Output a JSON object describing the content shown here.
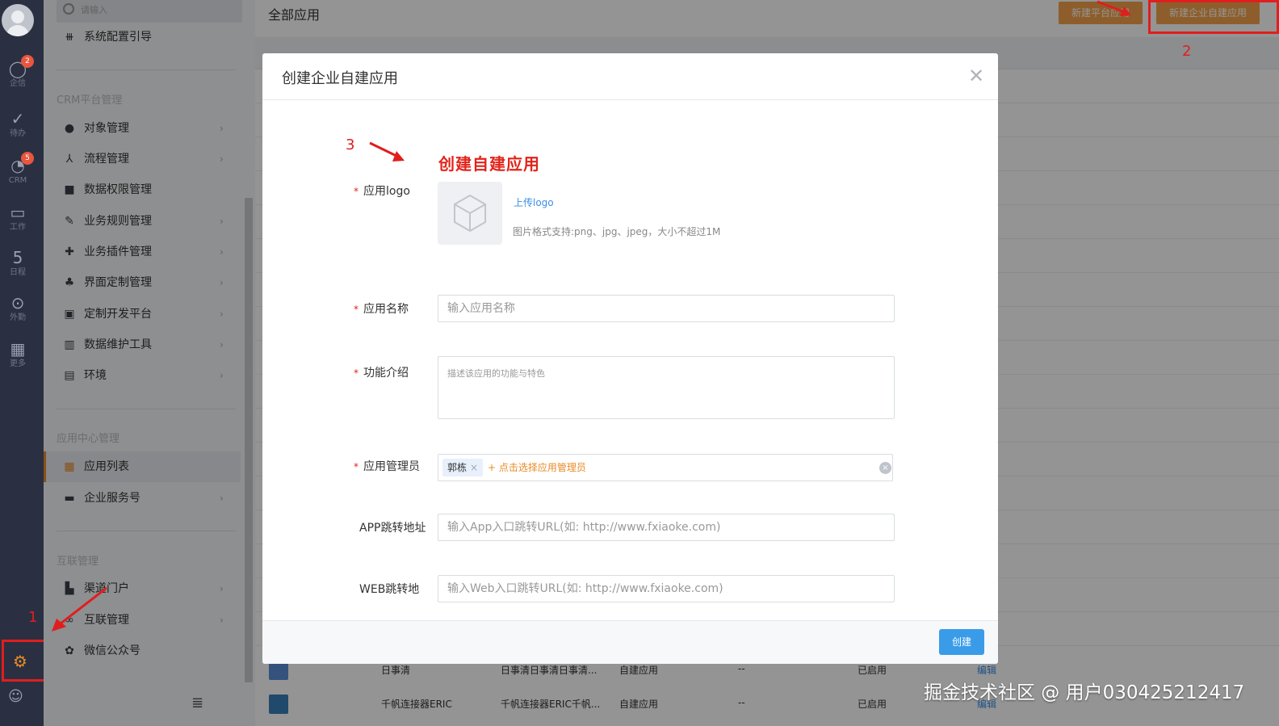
{
  "rail": {
    "items": [
      {
        "icon": "chat-icon",
        "glyph": "◯",
        "label": "企信",
        "badge": "2"
      },
      {
        "icon": "check-icon",
        "glyph": "✓",
        "label": "待办",
        "badge": ""
      },
      {
        "icon": "clock-icon",
        "glyph": "◔",
        "label": "CRM",
        "badge": "5"
      },
      {
        "icon": "briefcase-icon",
        "glyph": "▭",
        "label": "工作",
        "badge": ""
      },
      {
        "icon": "calendar-icon",
        "glyph": "5",
        "label": "日程",
        "badge": ""
      },
      {
        "icon": "location-icon",
        "glyph": "⊙",
        "label": "外勤",
        "badge": ""
      },
      {
        "icon": "grid-icon",
        "glyph": "▦",
        "label": "更多",
        "badge": ""
      }
    ],
    "settings_glyph": "⚙",
    "contacts_glyph": "☺"
  },
  "nav": {
    "search_placeholder": "请输入",
    "top_item": "系统配置引导",
    "group_crm": "CRM平台管理",
    "crm_items": [
      {
        "label": "对象管理",
        "icon": "user-icon",
        "glyph": "●",
        "chevron": true
      },
      {
        "label": "流程管理",
        "icon": "flow-icon",
        "glyph": "⅄",
        "chevron": true
      },
      {
        "label": "数据权限管理",
        "icon": "lock-icon",
        "glyph": "■",
        "chevron": false
      },
      {
        "label": "业务规则管理",
        "icon": "wrench-icon",
        "glyph": "✎",
        "chevron": true
      },
      {
        "label": "业务插件管理",
        "icon": "puzzle-icon",
        "glyph": "✚",
        "chevron": true
      },
      {
        "label": "界面定制管理",
        "icon": "paint-icon",
        "glyph": "♣",
        "chevron": true
      },
      {
        "label": "定制开发平台",
        "icon": "monitor-icon",
        "glyph": "▣",
        "chevron": true
      },
      {
        "label": "数据维护工具",
        "icon": "chart-icon",
        "glyph": "▥",
        "chevron": true
      },
      {
        "label": "环境",
        "icon": "pulse-icon",
        "glyph": "▤",
        "chevron": true
      }
    ],
    "group_app": "应用中心管理",
    "app_items": [
      {
        "label": "应用列表",
        "icon": "apps-icon",
        "glyph": "▦",
        "chevron": false,
        "active": true
      },
      {
        "label": "企业服务号",
        "icon": "screen-icon",
        "glyph": "▬",
        "chevron": true,
        "active": false
      }
    ],
    "group_link": "互联管理",
    "link_items": [
      {
        "label": "渠道门户",
        "icon": "building-icon",
        "glyph": "▙",
        "chevron": true
      },
      {
        "label": "互联管理",
        "icon": "link-icon",
        "glyph": "∞",
        "chevron": true
      },
      {
        "label": "微信公众号",
        "icon": "wechat-icon",
        "glyph": "✿",
        "chevron": false
      }
    ],
    "collapse_glyph": "≣",
    "chevron_glyph": "›"
  },
  "main": {
    "title": "全部应用",
    "btn_platform": "新建平台应用",
    "btn_enterprise": "新建企业自建应用",
    "rows": [
      {
        "name": "日事清",
        "desc": "日事清日事清日事清...",
        "type": "自建应用",
        "creator": "--",
        "status": "已启用",
        "action": "编辑",
        "thumb_color": "#5b8dd6"
      },
      {
        "name": "千帆连接器ERIC",
        "desc": "千帆连接器ERIC千帆...",
        "type": "自建应用",
        "creator": "--",
        "status": "已启用",
        "action": "编辑",
        "thumb_color": "#3a7fb8"
      }
    ]
  },
  "modal": {
    "title": "创建企业自建应用",
    "heading": "创建自建应用",
    "logo_label": "应用logo",
    "upload_link": "上传logo",
    "upload_hint": "图片格式支持:png、jpg、jpeg，大小不超过1M",
    "name_label": "应用名称",
    "name_placeholder": "输入应用名称",
    "desc_label": "功能介绍",
    "desc_placeholder": "描述该应用的功能与特色",
    "admin_label": "应用管理员",
    "admin_tag": "郭栋",
    "admin_add": "+ 点击选择应用管理员",
    "app_url_label": "APP跳转地址",
    "app_url_placeholder": "输入App入口跳转URL(如: http://www.fxiaoke.com)",
    "web_url_label": "WEB跳转地",
    "web_url_placeholder": "输入Web入口跳转URL(如: http://www.fxiaoke.com)",
    "create_button": "创建",
    "required_mark": "*"
  },
  "annotations": {
    "n1": "1",
    "n2": "2",
    "n3": "3"
  },
  "watermark": "掘金技术社区 @ 用户030425212417",
  "colors": {
    "accent": "#e98a25",
    "primary": "#3a9ce8",
    "annotation": "#e01e1e",
    "rail": "#2a3042"
  }
}
